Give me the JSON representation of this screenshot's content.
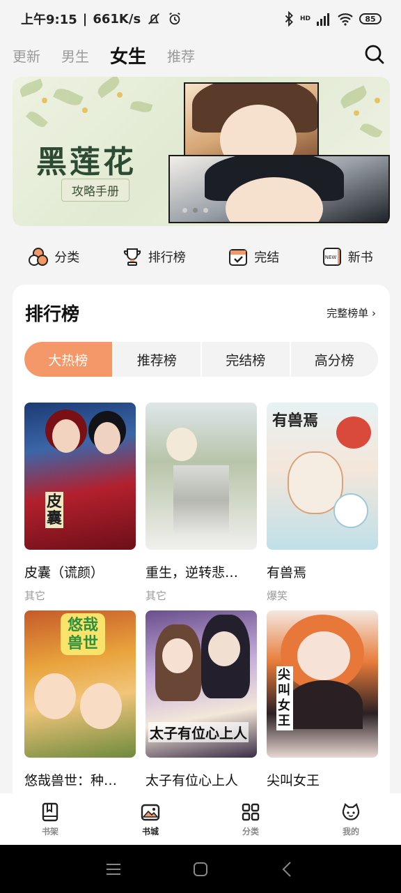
{
  "status_bar": {
    "time": "上午9:15",
    "speed": "661K/s",
    "battery": "85",
    "signal_label": "HD"
  },
  "top_tabs": [
    {
      "label": "更新",
      "active": false
    },
    {
      "label": "男生",
      "active": false
    },
    {
      "label": "女生",
      "active": true
    },
    {
      "label": "推荐",
      "active": false
    }
  ],
  "banner": {
    "title": "黑莲花",
    "subtitle": "攻略手册"
  },
  "quick_nav": [
    {
      "label": "分类",
      "icon": "category-icon"
    },
    {
      "label": "排行榜",
      "icon": "trophy-icon"
    },
    {
      "label": "完结",
      "icon": "calendar-check-icon"
    },
    {
      "label": "新书",
      "icon": "new-book-icon"
    }
  ],
  "ranking": {
    "title": "排行榜",
    "more_label": "完整榜单",
    "tabs": [
      {
        "label": "大热榜",
        "active": true
      },
      {
        "label": "推荐榜",
        "active": false
      },
      {
        "label": "完结榜",
        "active": false
      },
      {
        "label": "高分榜",
        "active": false
      }
    ],
    "books": [
      {
        "title": "皮囊（谎颜）",
        "genre": "其它",
        "cover_text": "皮囊"
      },
      {
        "title": "重生，逆转悲…",
        "genre": "其它",
        "cover_text": ""
      },
      {
        "title": "有兽焉",
        "genre": "爆笑",
        "cover_text": "有兽焉"
      },
      {
        "title": "悠哉兽世：种…",
        "genre": "",
        "cover_text": "悠哉兽世"
      },
      {
        "title": "太子有位心上人",
        "genre": "",
        "cover_text": "太子有位心上人"
      },
      {
        "title": "尖叫女王",
        "genre": "",
        "cover_text": "尖叫女王"
      }
    ]
  },
  "bottom_nav": [
    {
      "label": "书架",
      "icon": "bookshelf-icon",
      "active": false
    },
    {
      "label": "书城",
      "icon": "bookstore-icon",
      "active": true
    },
    {
      "label": "分类",
      "icon": "grid-icon",
      "active": false
    },
    {
      "label": "我的",
      "icon": "profile-icon",
      "active": false
    }
  ],
  "colors": {
    "accent": "#f59869",
    "background": "#f4f4f4",
    "text_primary": "#111111",
    "text_secondary": "#999999"
  }
}
